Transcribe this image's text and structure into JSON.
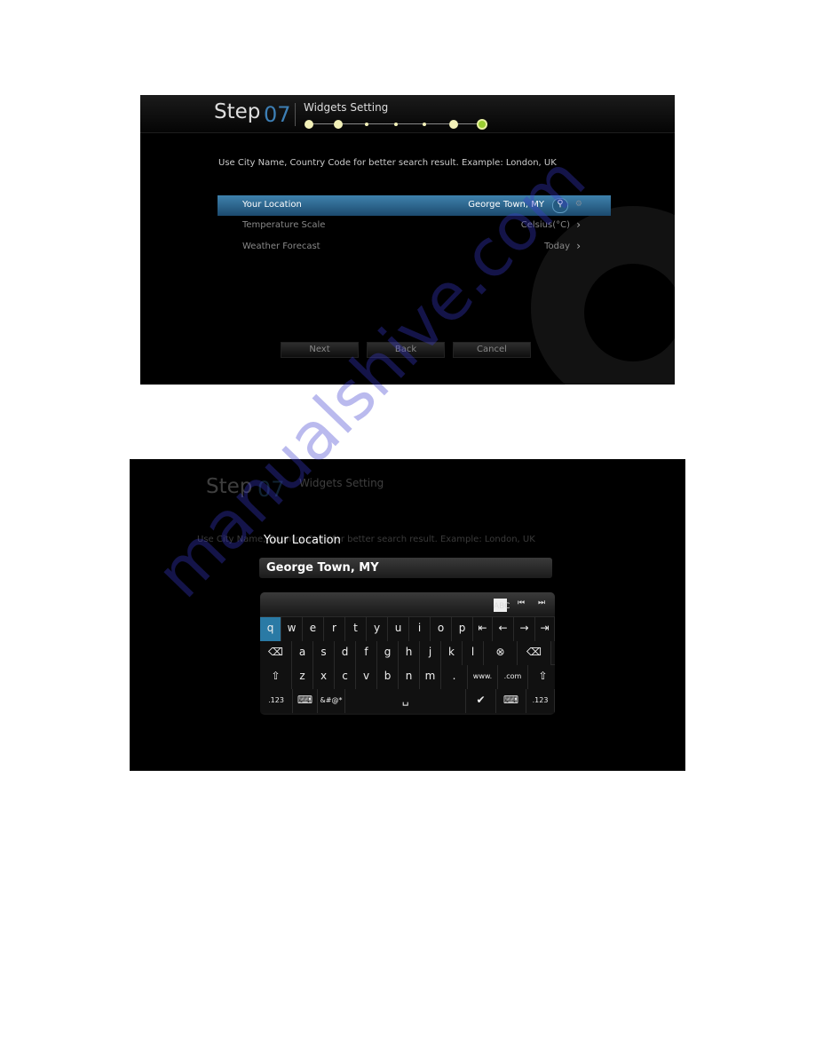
{
  "screen1": {
    "step_label": "Step",
    "step_number": "07",
    "title": "Widgets Setting",
    "progress": {
      "total_steps": 7,
      "current_step": 7
    },
    "hint": "Use City Name, Country Code for better search result. Example: London, UK",
    "rows": [
      {
        "label": "Your Location",
        "value": "George Town, MY",
        "selected": true,
        "icon": "search-icon"
      },
      {
        "label": "Temperature Scale",
        "value": "Celsius(°C)",
        "icon": "chevron-right-icon"
      },
      {
        "label": "Weather Forecast",
        "value": "Today",
        "icon": "chevron-right-icon"
      }
    ],
    "buttons": {
      "next": "Next",
      "back": "Back",
      "cancel": "Cancel"
    },
    "accent": "#3d7fb5"
  },
  "screen2": {
    "dialog_title": "Your Location",
    "input_value": "George Town, MY",
    "keyboard": {
      "top": [
        "ABC",
        "⏮",
        "⏭"
      ],
      "row1": [
        "q",
        "w",
        "e",
        "r",
        "t",
        "y",
        "u",
        "i",
        "o",
        "p",
        "⇤",
        "←",
        "→",
        "⇥"
      ],
      "row2": [
        "⌫",
        "a",
        "s",
        "d",
        "f",
        "g",
        "h",
        "j",
        "k",
        "l",
        "⊗",
        "⌫"
      ],
      "row3": [
        "⇧",
        "z",
        "x",
        "c",
        "v",
        "b",
        "n",
        "m",
        ".",
        "www.",
        ".com",
        "⇧"
      ],
      "row4": [
        ".123",
        "⌨",
        "&#@*",
        "␣",
        "✔",
        "⌨",
        ".123"
      ]
    }
  },
  "watermark": "manualshive.com"
}
